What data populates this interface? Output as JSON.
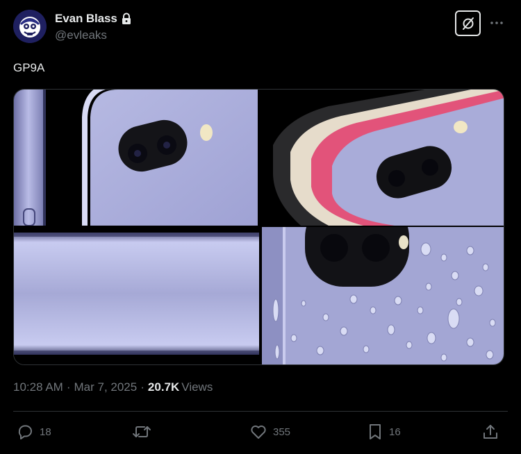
{
  "author": {
    "display_name": "Evan Blass",
    "handle": "@evleaks",
    "avatar_icon": "avatar-cartoon-face",
    "protected_icon": "lock-icon"
  },
  "header": {
    "grok_icon": "grok-icon",
    "more_icon": "more-dots-icon"
  },
  "tweet": {
    "text": "GP9A",
    "media": [
      {
        "name": "phone-side-camera-closeup"
      },
      {
        "name": "phones-color-lineup"
      },
      {
        "name": "phone-frame-edge"
      },
      {
        "name": "phone-water-droplets"
      }
    ]
  },
  "meta": {
    "time": "10:28 AM",
    "separator": "·",
    "date": "Mar 7, 2025",
    "views_count": "20.7K",
    "views_label": "Views"
  },
  "actions": {
    "reply": {
      "icon": "reply-icon",
      "count": "18"
    },
    "repost": {
      "icon": "repost-icon",
      "count": ""
    },
    "like": {
      "icon": "heart-icon",
      "count": "355"
    },
    "bookmark": {
      "icon": "bookmark-icon",
      "count": "16"
    },
    "share": {
      "icon": "share-icon",
      "count": ""
    }
  },
  "colors": {
    "background": "#000000",
    "text_primary": "#e7e9ea",
    "text_secondary": "#71767b",
    "divider": "#2f3336",
    "phone_lavender": "#a9acd9"
  }
}
